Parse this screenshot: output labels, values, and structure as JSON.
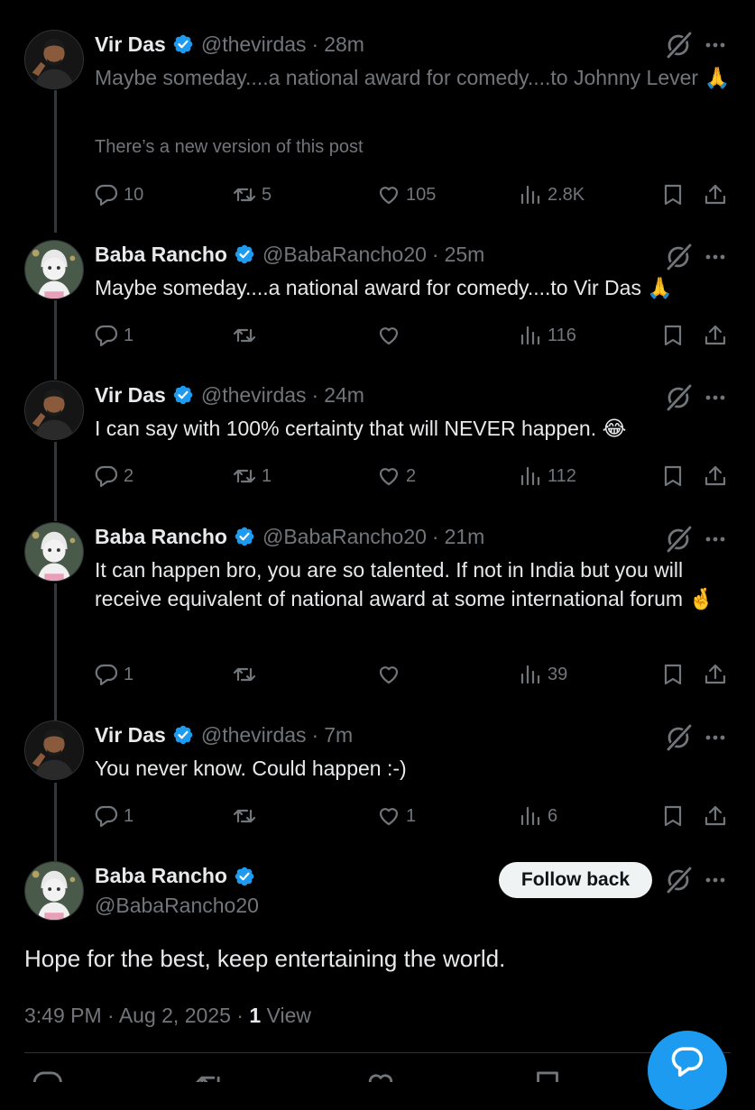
{
  "posts": [
    {
      "name": "Vir Das",
      "handle": "@thevirdas",
      "time": "28m",
      "text": "Maybe someday....a national award for comedy....to Johnny Lever 🙏",
      "note": "There’s a new version of this post",
      "replies": "10",
      "reposts": "5",
      "likes": "105",
      "views": "2.8K"
    },
    {
      "name": "Baba Rancho",
      "handle": "@BabaRancho20",
      "time": "25m",
      "text": "Maybe someday....a national award for comedy....to Vir Das 🙏",
      "replies": "1",
      "reposts": "",
      "likes": "",
      "views": "116"
    },
    {
      "name": "Vir Das",
      "handle": "@thevirdas",
      "time": "24m",
      "text": "I can say with 100% certainty that will NEVER happen. 😂",
      "replies": "2",
      "reposts": "1",
      "likes": "2",
      "views": "112"
    },
    {
      "name": "Baba Rancho",
      "handle": "@BabaRancho20",
      "time": "21m",
      "text": "It can happen bro, you are so talented. If not in India but you will receive equivalent of national award at some international forum 🤞",
      "replies": "1",
      "reposts": "",
      "likes": "",
      "views": "39"
    },
    {
      "name": "Vir Das",
      "handle": "@thevirdas",
      "time": "7m",
      "text": "You never know. Could happen :-)",
      "replies": "1",
      "reposts": "",
      "likes": "1",
      "views": "6"
    }
  ],
  "main": {
    "name": "Baba Rancho",
    "handle": "@BabaRancho20",
    "follow_label": "Follow back",
    "text": "Hope for the best, keep entertaining the world.",
    "time": "3:49 PM",
    "date": "Aug 2, 2025",
    "view_count": "1",
    "view_label": "View"
  },
  "icons": {
    "verified": "verified-badge-icon",
    "grok": "grok-icon",
    "more": "more-icon",
    "reply": "reply-icon",
    "repost": "repost-icon",
    "like": "like-icon",
    "views": "views-icon",
    "bookmark": "bookmark-icon",
    "share": "share-icon",
    "compose": "compose-reply-icon"
  },
  "colors": {
    "background": "#000000",
    "text": "#e7e9ea",
    "muted": "#71767b",
    "accent": "#1d9bf0",
    "button": "#eff3f4"
  }
}
